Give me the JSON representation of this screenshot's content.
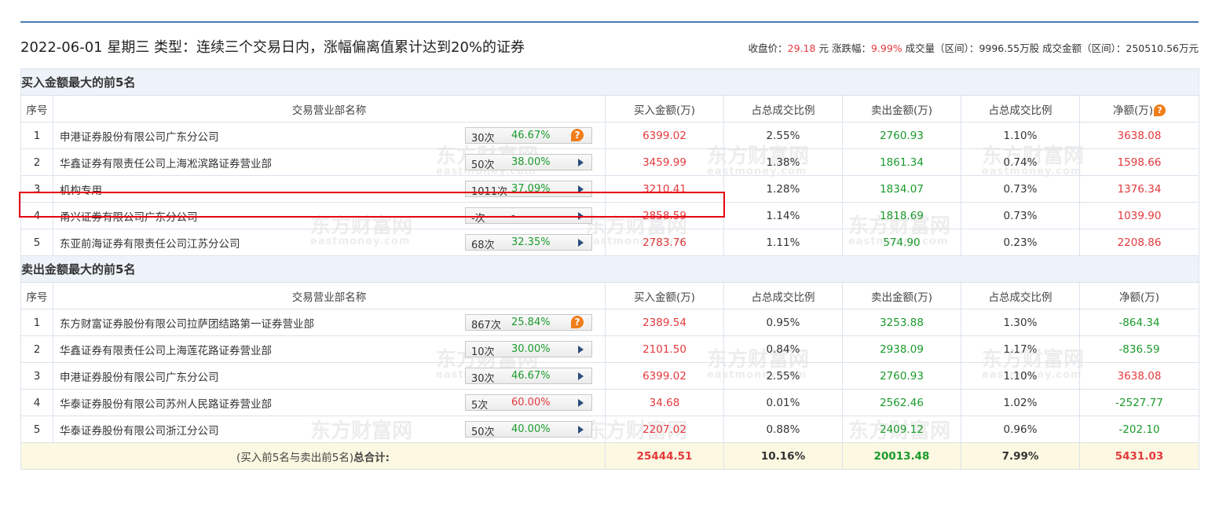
{
  "header": {
    "date_title": "2022-06-01 星期三 类型：连续三个交易日内，涨幅偏离值累计达到20%的证券",
    "close_label": "收盘价：",
    "close_value": "29.18",
    "close_unit": "元",
    "change_label": "涨跌幅：",
    "change_value": "9.99%",
    "volume_label": "成交量（区间）：",
    "volume_value": "9996.55万股",
    "amount_label": "成交金额（区间）：",
    "amount_value": "250510.56万元"
  },
  "watermark": {
    "cn": "东方财富网",
    "en": "eastmoney.com"
  },
  "columns": {
    "seq": "序号",
    "name": "交易营业部名称",
    "buy": "买入金额(万)",
    "buy_ratio": "占总成交比例",
    "sell": "卖出金额(万)",
    "sell_ratio": "占总成交比例",
    "net": "净额(万)"
  },
  "buy_section": {
    "title": "买入金额最大的前5名",
    "rows": [
      {
        "seq": "1",
        "name": "申港证券股份有限公司广东分公司",
        "times": "30次",
        "rate": "46.67%",
        "rate_color": "green",
        "icon": "question-icon",
        "buy": "6399.02",
        "buy_ratio": "2.55%",
        "sell": "2760.93",
        "sell_ratio": "1.10%",
        "net": "3638.08",
        "net_color": "red"
      },
      {
        "seq": "2",
        "name": "华鑫证券有限责任公司上海凇滨路证券营业部",
        "times": "50次",
        "rate": "38.00%",
        "rate_color": "green",
        "icon": "play-icon",
        "buy": "3459.99",
        "buy_ratio": "1.38%",
        "sell": "1861.34",
        "sell_ratio": "0.74%",
        "net": "1598.66",
        "net_color": "red"
      },
      {
        "seq": "3",
        "name": "机构专用",
        "times": "1011次",
        "rate": "37.09%",
        "rate_color": "green",
        "icon": "play-icon",
        "buy": "3210.41",
        "buy_ratio": "1.28%",
        "sell": "1834.07",
        "sell_ratio": "0.73%",
        "net": "1376.34",
        "net_color": "red"
      },
      {
        "seq": "4",
        "name": "甬兴证券有限公司广东分公司",
        "times": "-次",
        "rate": "-",
        "rate_color": "gray",
        "icon": "play-icon",
        "buy": "2858.59",
        "buy_ratio": "1.14%",
        "sell": "1818.69",
        "sell_ratio": "0.73%",
        "net": "1039.90",
        "net_color": "red"
      },
      {
        "seq": "5",
        "name": "东亚前海证券有限责任公司江苏分公司",
        "times": "68次",
        "rate": "32.35%",
        "rate_color": "green",
        "icon": "play-icon",
        "buy": "2783.76",
        "buy_ratio": "1.11%",
        "sell": "574.90",
        "sell_ratio": "0.23%",
        "net": "2208.86",
        "net_color": "red"
      }
    ]
  },
  "sell_section": {
    "title": "卖出金额最大的前5名",
    "rows": [
      {
        "seq": "1",
        "name": "东方财富证券股份有限公司拉萨团结路第一证券营业部",
        "times": "867次",
        "rate": "25.84%",
        "rate_color": "green",
        "icon": "question-icon",
        "buy": "2389.54",
        "buy_ratio": "0.95%",
        "sell": "3253.88",
        "sell_ratio": "1.30%",
        "net": "-864.34",
        "net_color": "green"
      },
      {
        "seq": "2",
        "name": "华鑫证券有限责任公司上海莲花路证券营业部",
        "times": "10次",
        "rate": "30.00%",
        "rate_color": "green",
        "icon": "play-icon",
        "buy": "2101.50",
        "buy_ratio": "0.84%",
        "sell": "2938.09",
        "sell_ratio": "1.17%",
        "net": "-836.59",
        "net_color": "green"
      },
      {
        "seq": "3",
        "name": "申港证券股份有限公司广东分公司",
        "times": "30次",
        "rate": "46.67%",
        "rate_color": "green",
        "icon": "play-icon",
        "buy": "6399.02",
        "buy_ratio": "2.55%",
        "sell": "2760.93",
        "sell_ratio": "1.10%",
        "net": "3638.08",
        "net_color": "red"
      },
      {
        "seq": "4",
        "name": "华泰证券股份有限公司苏州人民路证券营业部",
        "times": "5次",
        "rate": "60.00%",
        "rate_color": "red",
        "icon": "play-icon",
        "buy": "34.68",
        "buy_ratio": "0.01%",
        "sell": "2562.46",
        "sell_ratio": "1.02%",
        "net": "-2527.77",
        "net_color": "green"
      },
      {
        "seq": "5",
        "name": "华泰证券股份有限公司浙江分公司",
        "times": "50次",
        "rate": "40.00%",
        "rate_color": "green",
        "icon": "play-icon",
        "buy": "2207.02",
        "buy_ratio": "0.88%",
        "sell": "2409.12",
        "sell_ratio": "0.96%",
        "net": "-202.10",
        "net_color": "green"
      }
    ]
  },
  "total": {
    "label_prefix": "(买入前5名与卖出前5名)",
    "label_bold": "总合计:",
    "buy": "25444.51",
    "buy_ratio": "10.16%",
    "sell": "20013.48",
    "sell_ratio": "7.99%",
    "net": "5431.03"
  },
  "colors": {
    "accent": "#4a7ab4",
    "up": "#e4393c",
    "down": "#1a9a2a",
    "highlight": "#e60012"
  }
}
